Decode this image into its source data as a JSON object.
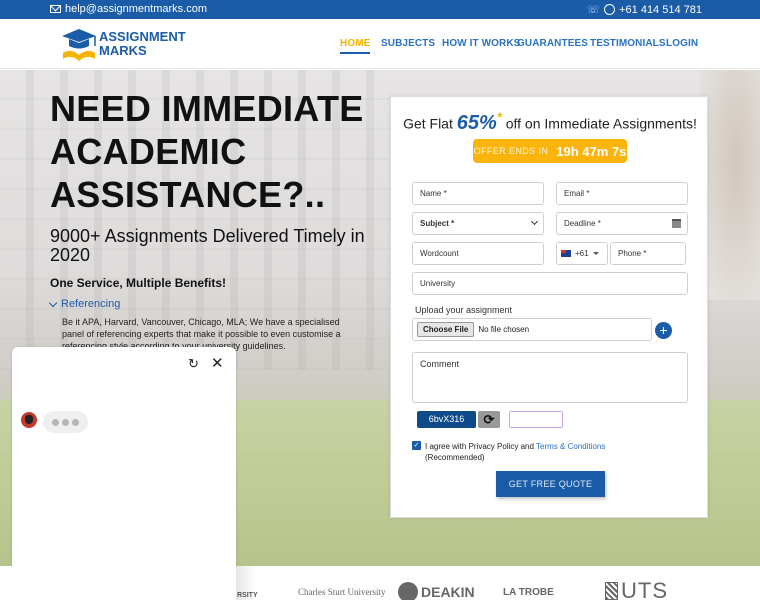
{
  "topbar": {
    "email": "help@assignmentmarks.com",
    "phone": "+61 414 514 781"
  },
  "logo": {
    "line1": "ASSIGNMENT",
    "line2": "MARKS"
  },
  "nav": {
    "items": [
      {
        "label": "HOME",
        "active": true
      },
      {
        "label": "SUBJECTS"
      },
      {
        "label": "HOW IT WORKS"
      },
      {
        "label": "GUARANTEES"
      },
      {
        "label": "TESTIMONIALS"
      },
      {
        "label": "LOGIN"
      }
    ]
  },
  "hero": {
    "title_lines": [
      "NEED IMMEDIATE",
      "ACADEMIC",
      "ASSISTANCE?.."
    ],
    "subtitle": "9000+ Assignments Delivered Timely in 2020",
    "benefits_heading": "One Service, Multiple Benefits!",
    "accordion": {
      "label": "Referencing",
      "body": "Be it APA, Harvard, Vancouver, Chicago, MLA; We have a specialised panel of referencing experts that make it possible to even customise a referencing style according to your university guidelines."
    }
  },
  "form": {
    "offer_prefix": "Get Flat ",
    "offer_pct": "65%",
    "offer_star": "*",
    "offer_suffix": " off on Immediate Assignments!",
    "timer_label": "OFFER ENDS IN",
    "timer_value": "19h 47m 7s",
    "name_placeholder": "Name *",
    "email_placeholder": "Email *",
    "subject_selected": "Subject *",
    "deadline_placeholder": "Deadline *",
    "wordcount_placeholder": "Wordcount",
    "country_code": "+61",
    "phone_placeholder": "Phone *",
    "university_placeholder": "University",
    "upload_label": "Upload your assignment",
    "file_button": "Choose File",
    "file_status": "No file chosen",
    "comment_placeholder": "Comment",
    "captcha_text": "6bvX316",
    "agree_text": "I agree with Privacy Policy and ",
    "agree_link": "Terms & Conditions",
    "agree_note": "(Recommended)",
    "agree_checked": true,
    "submit_label": "GET FREE QUOTE"
  },
  "chat": {
    "reload_icon": "↻",
    "close_icon": "✕"
  },
  "universities": [
    "Charles Sturt University",
    "DEAKIN",
    "LA TROBE",
    "UTS"
  ]
}
